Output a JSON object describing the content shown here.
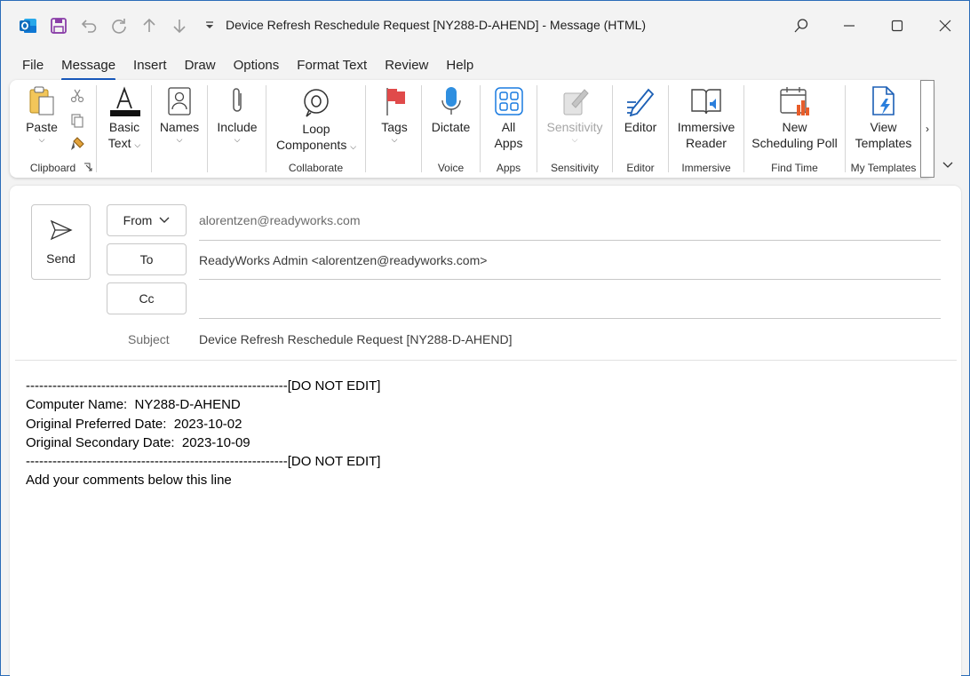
{
  "window": {
    "title": "Device Refresh Reschedule Request [NY288-D-AHEND]  -  Message (HTML)"
  },
  "quick_access": [
    "outlook-icon",
    "save-icon",
    "undo-icon",
    "redo-icon",
    "up-arrow-icon",
    "down-arrow-icon",
    "customize-icon"
  ],
  "menu_tabs": [
    "File",
    "Message",
    "Insert",
    "Draw",
    "Options",
    "Format Text",
    "Review",
    "Help"
  ],
  "active_tab": "Message",
  "ribbon": {
    "paste": "Paste",
    "basic_text_1": "Basic",
    "basic_text_2": "Text",
    "names": "Names",
    "include": "Include",
    "loop_1": "Loop",
    "loop_2": "Components",
    "tags": "Tags",
    "dictate": "Dictate",
    "all_apps_1": "All",
    "all_apps_2": "Apps",
    "sensitivity": "Sensitivity",
    "editor": "Editor",
    "immersive_1": "Immersive",
    "immersive_2": "Reader",
    "new_poll_1": "New",
    "new_poll_2": "Scheduling Poll",
    "view_templates_1": "View",
    "view_templates_2": "Templates",
    "groups": {
      "clipboard": "Clipboard",
      "collaborate": "Collaborate",
      "voice": "Voice",
      "apps": "Apps",
      "sensitivity": "Sensitivity",
      "editor": "Editor",
      "immersive": "Immersive",
      "find_time": "Find Time",
      "my_templates": "My Templates"
    }
  },
  "compose": {
    "send_label": "Send",
    "from_label": "From",
    "from_value": "alorentzen@readyworks.com",
    "to_label": "To",
    "to_value": "ReadyWorks Admin <alorentzen@readyworks.com>",
    "cc_label": "Cc",
    "cc_value": "",
    "subject_label": "Subject",
    "subject_value": "Device Refresh Reschedule Request [NY288-D-AHEND]"
  },
  "body": {
    "line1": "-----------------------------------------------------------[DO NOT EDIT]",
    "line2": "Computer Name:  NY288-D-AHEND",
    "line3": "Original Preferred Date:  2023-10-02",
    "line4": "Original Secondary Date:  2023-10-09",
    "line5": "-----------------------------------------------------------[DO NOT EDIT]",
    "line6": "Add your comments below this line"
  },
  "colors": {
    "accent": "#185abd",
    "outlook_blue": "#0f6cbd",
    "save_purple": "#8a3ea8",
    "tag_red": "#e04a4a"
  }
}
